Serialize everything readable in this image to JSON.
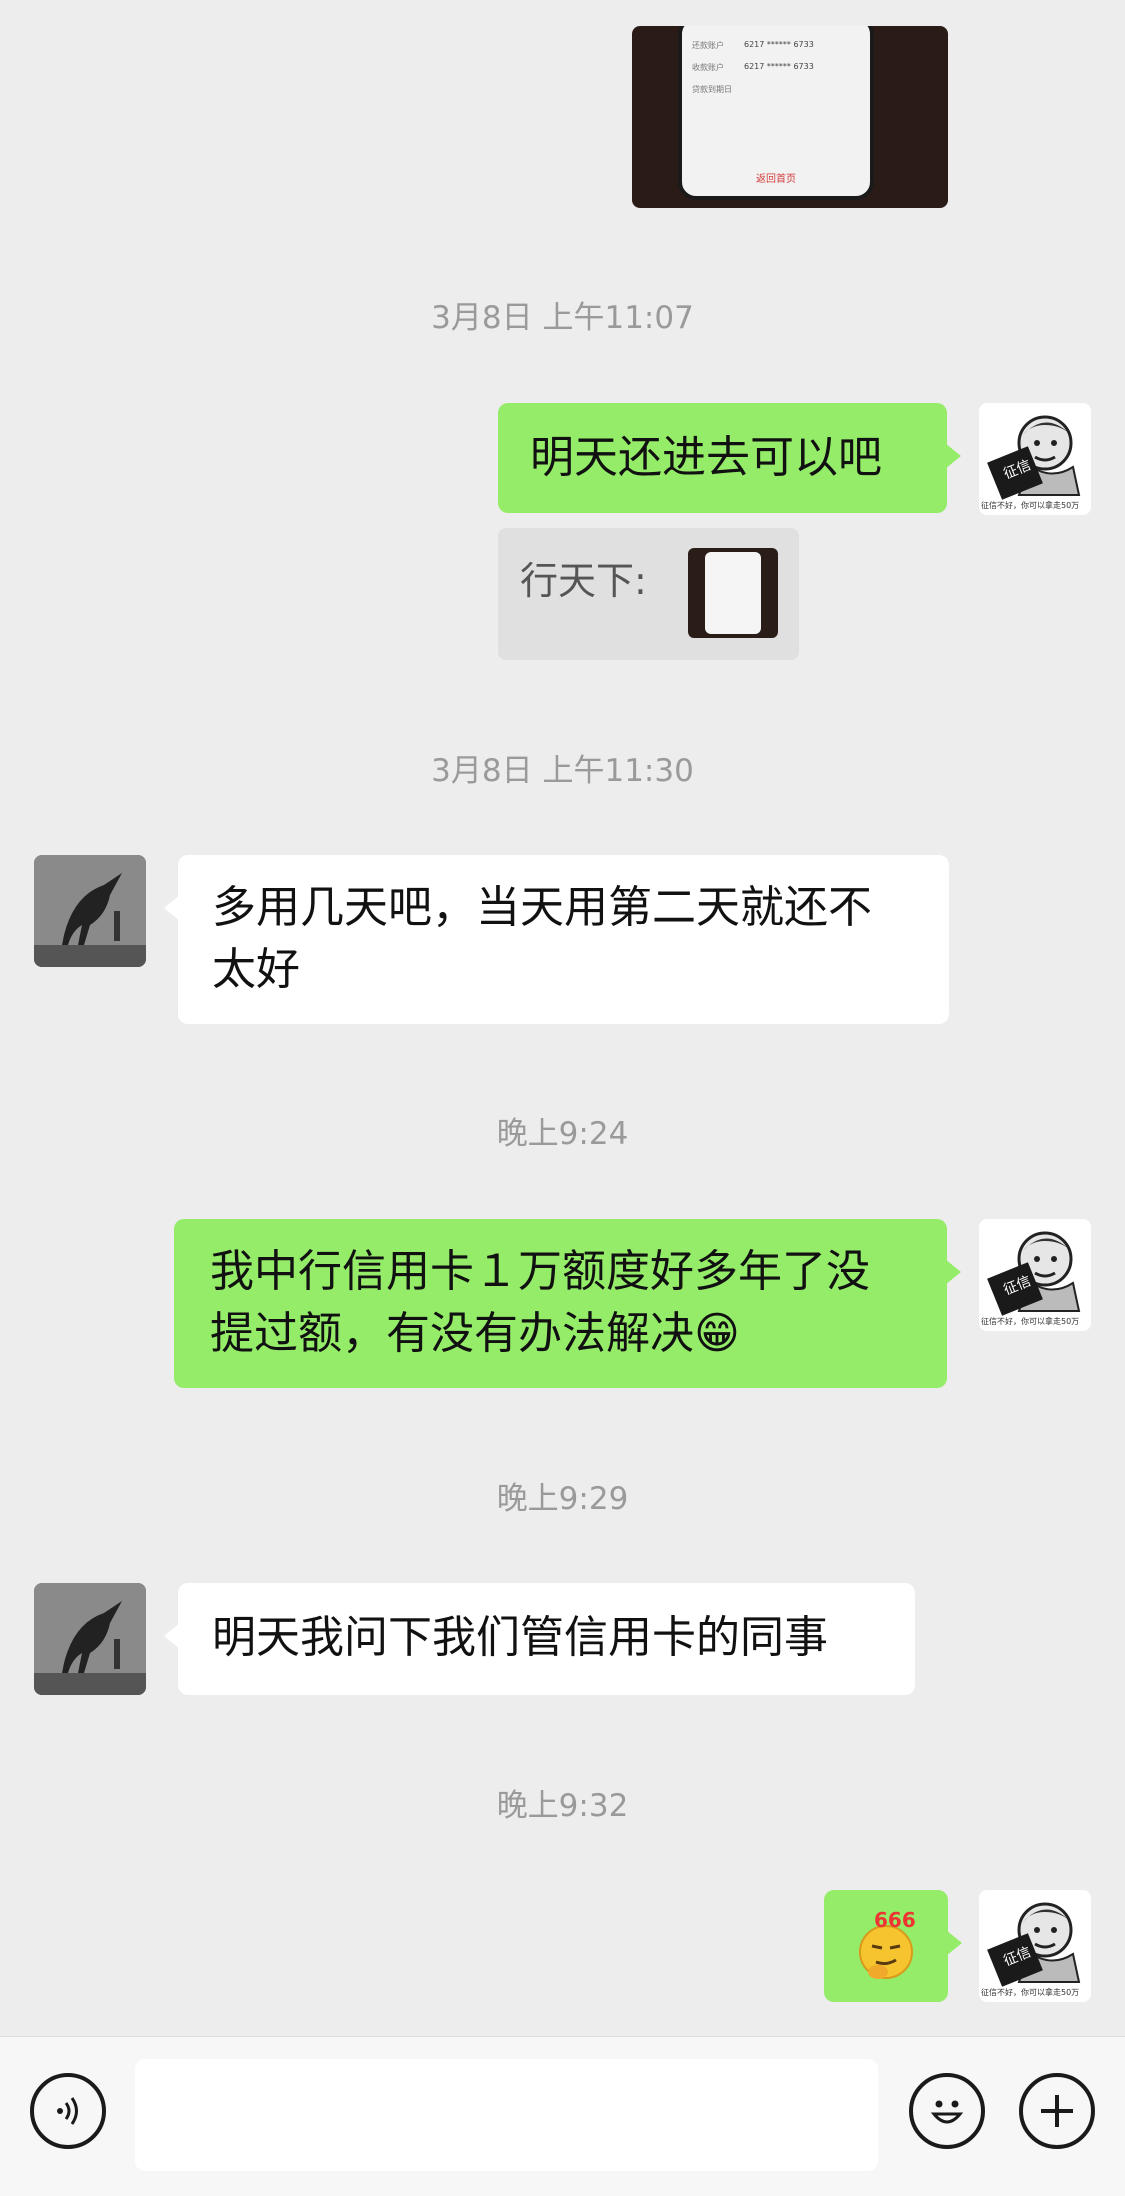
{
  "photo_message": {
    "rows": [
      {
        "label": "还款账户",
        "value": "6217 ****** 6733"
      },
      {
        "label": "收款账户",
        "value": "6217 ****** 6733"
      },
      {
        "label": "贷款到期日",
        "value": ""
      }
    ],
    "footer_link": "返回首页"
  },
  "timestamps": [
    "3月8日 上午11:07",
    "3月8日 上午11:30",
    "晚上9:24",
    "晚上9:29",
    "晚上9:32"
  ],
  "messages": [
    {
      "sender": "self",
      "text": "明天还进去可以吧"
    },
    {
      "sender": "other",
      "text": "多用几天吧，当天用第二天就还不太好"
    },
    {
      "sender": "self",
      "text": "我中行信用卡１万额度好多年了没提过额，有没有办法解决😁"
    },
    {
      "sender": "other",
      "text": "明天我问下我们管信用卡的同事"
    },
    {
      "sender": "self",
      "sticker": "666-emoji"
    }
  ],
  "quote": {
    "author": "行天下:",
    "thumbnail": "image-thumbnail"
  },
  "self_avatar": {
    "caption": "征信不好，你可以拿走50万",
    "badge": "征信"
  },
  "sticker_text": "666",
  "input_bar": {
    "left_icon": "voice-icon",
    "right_icons": [
      "emoji-icon",
      "plus-icon"
    ]
  },
  "colors": {
    "self_bubble": "#95ec69",
    "other_bubble": "#ffffff",
    "background": "#ededed"
  }
}
